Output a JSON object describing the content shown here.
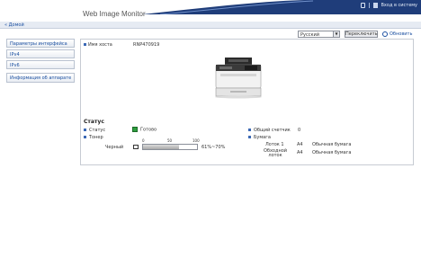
{
  "header": {
    "app_title": "Web Image Monitor",
    "login_label": "Вход в систему"
  },
  "breadcrumb": {
    "home": "« Домой"
  },
  "sidebar": {
    "items": [
      {
        "label": "Параметры интерфейса"
      },
      {
        "label": "IPv4"
      },
      {
        "label": "IPv6"
      },
      {
        "label": "Информация об аппарате"
      }
    ]
  },
  "controls": {
    "language_selected": "Русский",
    "switch_label": "Переключить",
    "refresh_label": "Обновить"
  },
  "device": {
    "host_label": "Имя хоста",
    "host_value": "RNP470919"
  },
  "status": {
    "title": "Статус",
    "status_label": "Статус",
    "status_value": "Готово",
    "toner_label": "Тонер",
    "toner_color": "Черный",
    "toner_scale": [
      "0",
      "50",
      "100"
    ],
    "toner_level_text": "61%~70%",
    "toner_level_fraction": 0.66,
    "counter_label": "Общий счетчик",
    "counter_value": "0",
    "paper_label": "Бумага",
    "trays": [
      {
        "name": "Лоток 1",
        "size": "A4",
        "type": "Обычная бумага"
      },
      {
        "name": "Обходной лоток",
        "size": "A4",
        "type": "Обычная бумага"
      }
    ]
  },
  "colors": {
    "header_blue": "#1f3d7a",
    "link_blue": "#1a4fa0",
    "ready_green": "#2e9e3f",
    "bullet_blue": "#3b68b5"
  }
}
